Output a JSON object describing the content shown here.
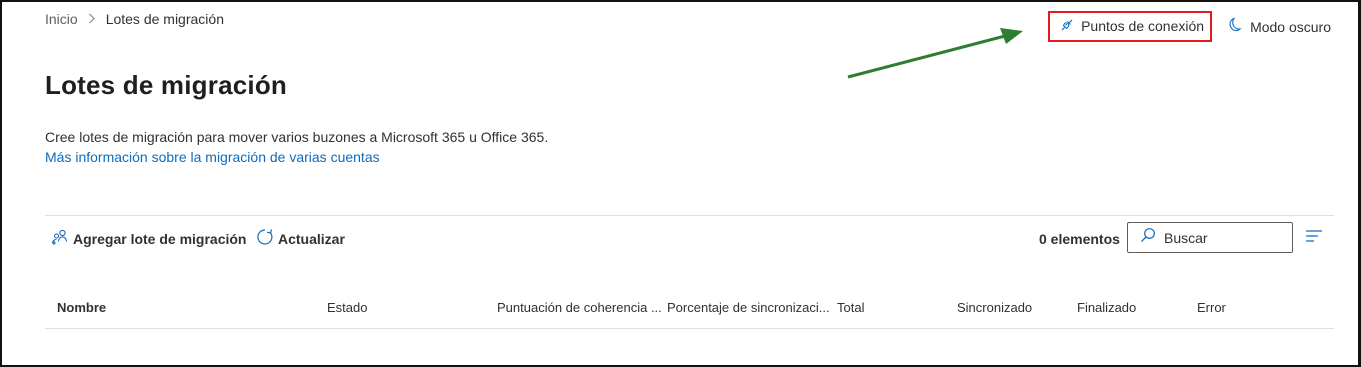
{
  "breadcrumb": {
    "home": "Inicio",
    "current": "Lotes de migración"
  },
  "top_actions": {
    "connection_points": "Puntos de conexión",
    "dark_mode": "Modo oscuro"
  },
  "page": {
    "title": "Lotes de migración",
    "description": "Cree lotes de migración para mover varios buzones a Microsoft 365 u Office 365.",
    "learn_more": "Más información sobre la migración de varias cuentas"
  },
  "toolbar": {
    "add_label": "Agregar lote de migración",
    "refresh_label": "Actualizar",
    "item_count": "0 elementos",
    "search_placeholder": "Buscar"
  },
  "table": {
    "columns": [
      "Nombre",
      "Estado",
      "Puntuación de coherencia ...",
      "Porcentaje de sincronizaci...",
      "Total",
      "Sincronizado",
      "Finalizado",
      "Error"
    ]
  },
  "colors": {
    "accent": "#0f6cbd",
    "highlight_box": "#e01c1c",
    "annotation_arrow": "#2e7d32"
  },
  "icons": [
    "chevron-right-icon",
    "plug-icon",
    "moon-icon",
    "add-people-icon",
    "refresh-icon",
    "search-icon",
    "filter-icon"
  ]
}
